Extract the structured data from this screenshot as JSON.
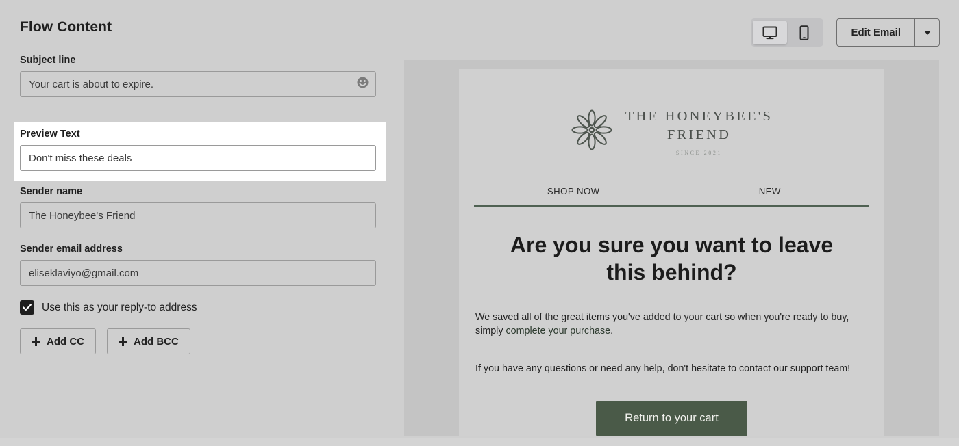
{
  "header": {
    "title": "Flow Content",
    "view_toggle": {
      "desktop": {
        "icon": "desktop-monitor-icon",
        "label": "Desktop preview",
        "selected": true
      },
      "mobile": {
        "icon": "mobile-phone-icon",
        "label": "Mobile preview",
        "selected": false
      }
    },
    "edit_email_label": "Edit Email",
    "edit_email_caret_icon": "chevron-down-icon"
  },
  "form": {
    "subject": {
      "label": "Subject line",
      "value": "Your cart is about to expire.",
      "placeholder": "Subject line",
      "emoji_icon": "smiley-face-icon"
    },
    "preview_text": {
      "label": "Preview Text",
      "value": "Don't miss these deals",
      "placeholder": "Preview Text",
      "highlighted": true
    },
    "sender_name": {
      "label": "Sender name",
      "value": "The Honeybee's Friend",
      "placeholder": "Sender name"
    },
    "sender_email": {
      "label": "Sender email address",
      "value": "eliseklaviyo@gmail.com",
      "placeholder": "Sender email address"
    },
    "reply_to": {
      "label": "Use this as your reply-to address",
      "checked": true,
      "check_icon": "checkmark-icon"
    },
    "add_cc_label": "Add CC",
    "add_bcc_label": "Add BCC",
    "plus_icon": "plus-icon"
  },
  "email_preview": {
    "logo": {
      "mark_icon": "flower-petal-icon",
      "name_line1": "THE HONEYBEE'S",
      "name_line2": "FRIEND",
      "tagline": "SINCE 2021"
    },
    "nav": [
      {
        "label": "SHOP NOW"
      },
      {
        "label": "NEW"
      }
    ],
    "headline": "Are you sure you want to leave this behind?",
    "body_1_before": "We saved all of the great items you've added to your cart so when you're ready to buy, simply ",
    "body_1_link": "complete your purchase",
    "body_1_after": ".",
    "body_2": "If you have any questions or need any help, don't hesitate to contact our support team!",
    "cta_label": "Return to your cart"
  },
  "colors": {
    "page_background": "#cfcfcf",
    "preview_pane": "#c4c4c4",
    "email_body": "#d0d0d0",
    "cta_green": "#4a5a48",
    "rule_green": "#4f6152",
    "logo_green": "#4a4f4b",
    "highlight_white": "#ffffff"
  }
}
